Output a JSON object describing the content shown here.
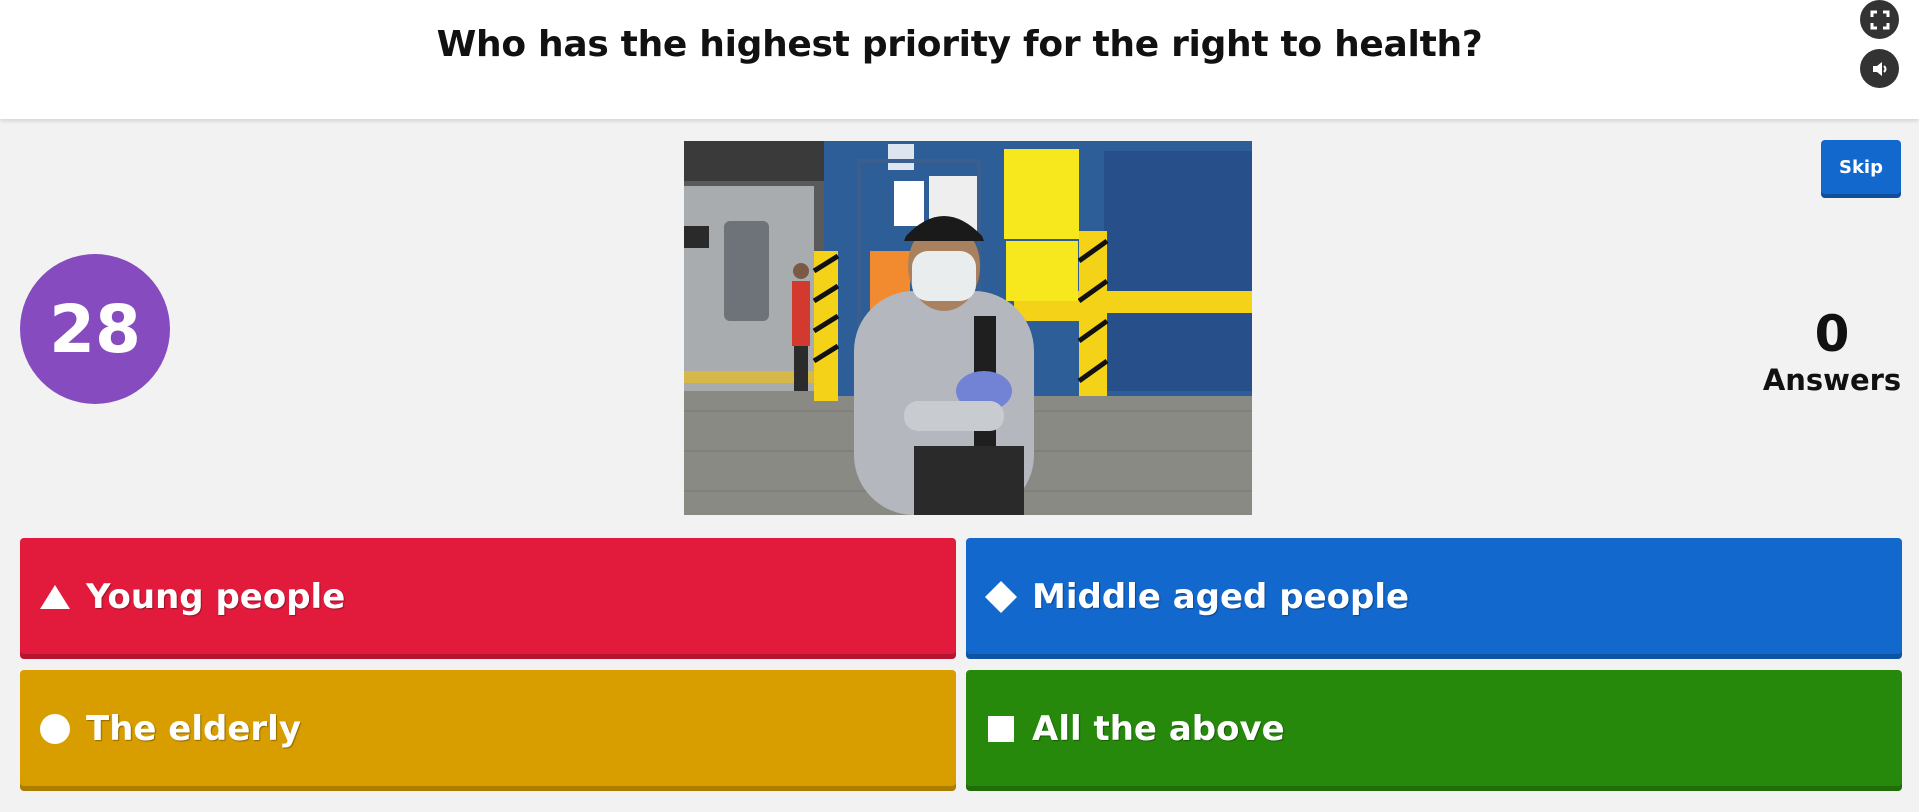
{
  "question": "Who has the highest priority for the right to health?",
  "controls": {
    "fullscreen_icon": "fullscreen-icon",
    "sound_icon": "speaker-icon",
    "skip_label": "Skip"
  },
  "timer": "28",
  "answers_count": {
    "value": "0",
    "label": "Answers"
  },
  "media": {
    "description_icon": "photo-image"
  },
  "options": [
    {
      "label": "Young people",
      "shape": "triangle-icon",
      "color": "#e21b3c"
    },
    {
      "label": "Middle aged people",
      "shape": "diamond-icon",
      "color": "#1368ce"
    },
    {
      "label": "The elderly",
      "shape": "circle-icon",
      "color": "#d89e00"
    },
    {
      "label": "All the above",
      "shape": "square-icon",
      "color": "#26890c"
    }
  ],
  "colors": {
    "timer": "#864cbf",
    "skip": "#1368ce",
    "background": "#f2f2f2"
  }
}
